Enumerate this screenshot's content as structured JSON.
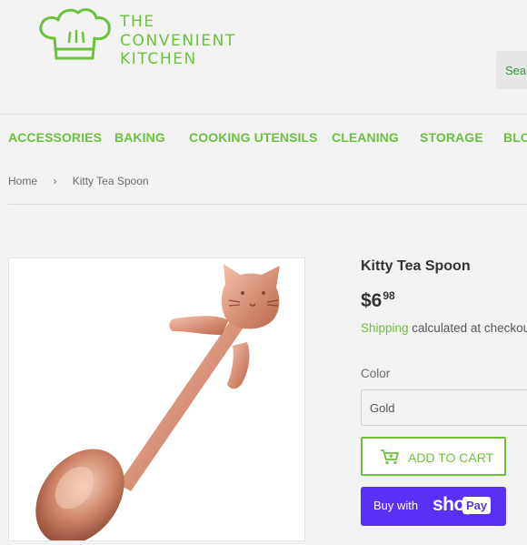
{
  "brand": {
    "lines": [
      "THE",
      "CONVENIENT",
      "KITCHEN"
    ],
    "logo_icon": "chef-hat-icon",
    "color": "#6dc13f"
  },
  "search": {
    "placeholder": "Sear"
  },
  "nav": {
    "items": [
      "ACCESSORIES",
      "BAKING",
      "COOKING UTENSILS",
      "CLEANING",
      "STORAGE",
      "BLO"
    ]
  },
  "breadcrumb": {
    "home": "Home",
    "separator": "›",
    "current": "Kitty Tea Spoon"
  },
  "product": {
    "title": "Kitty Tea Spoon",
    "price_main": "$6",
    "price_cents": "98",
    "shipping_link": "Shipping",
    "shipping_text": " calculated at checkout",
    "image_icon": "rose-gold-cat-spoon-image",
    "color_label": "Color",
    "color_value": "Gold",
    "add_to_cart": "ADD TO CART",
    "cart_icon": "cart-icon",
    "buy_with": "Buy with",
    "shop": "shop",
    "pay": "Pay",
    "buy_button_color": "#5a31f4"
  }
}
